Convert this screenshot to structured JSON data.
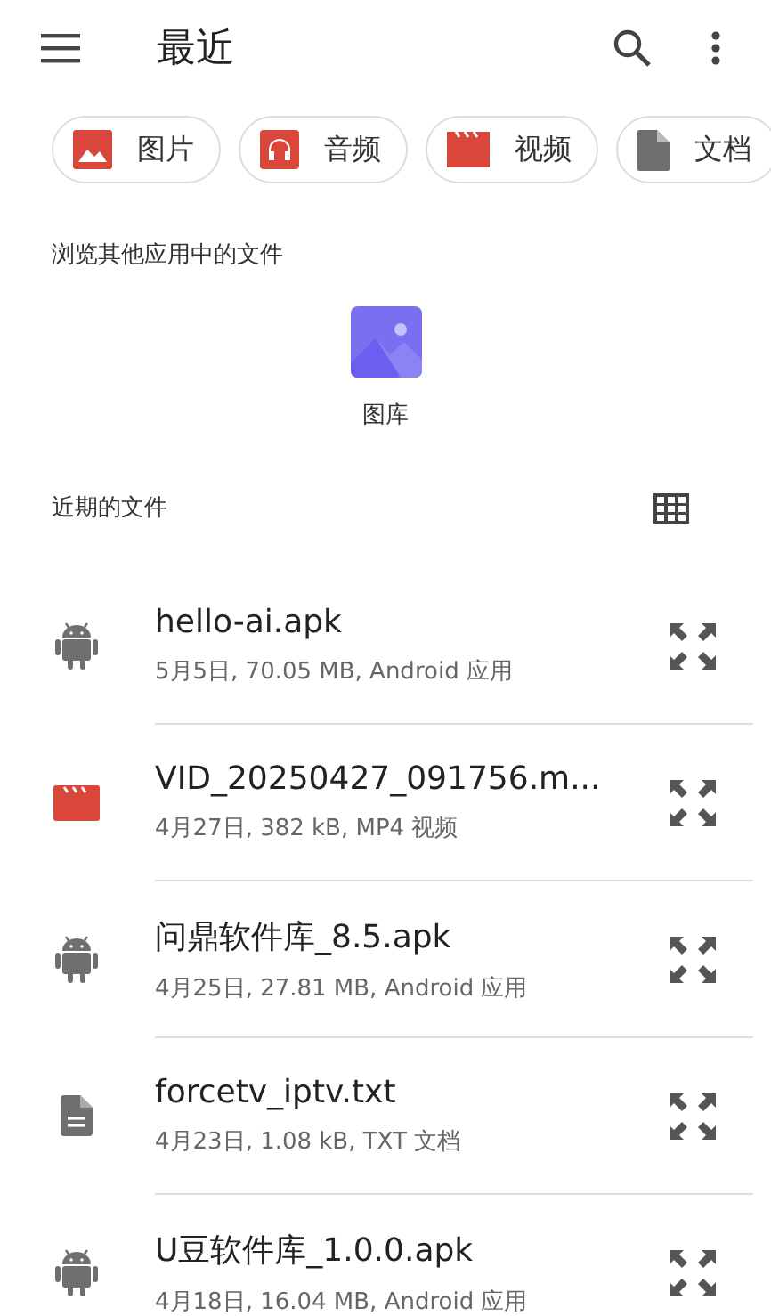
{
  "app_bar": {
    "title": "最近"
  },
  "chips": [
    {
      "kind": "image",
      "label": "图片"
    },
    {
      "kind": "audio",
      "label": "音频"
    },
    {
      "kind": "video",
      "label": "视频"
    },
    {
      "kind": "document",
      "label": "文档"
    }
  ],
  "other_apps": {
    "heading": "浏览其他应用中的文件",
    "apps": [
      {
        "label": "图库"
      }
    ]
  },
  "recent": {
    "heading": "近期的文件",
    "files": [
      {
        "kind": "apk",
        "name": "hello-ai.apk",
        "details": "5月5日, 70.05 MB, Android 应用"
      },
      {
        "kind": "video",
        "name": "VID_20250427_091756.m...",
        "details": "4月27日, 382 kB, MP4 视频"
      },
      {
        "kind": "apk",
        "name": "问鼎软件库_8.5.apk",
        "details": "4月25日, 27.81 MB, Android 应用"
      },
      {
        "kind": "text",
        "name": "forcetv_iptv.txt",
        "details": "4月23日, 1.08 kB, TXT 文档"
      },
      {
        "kind": "apk",
        "name": "U豆软件库_1.0.0.apk",
        "details": "4月18日, 16.04 MB, Android 应用"
      }
    ]
  }
}
